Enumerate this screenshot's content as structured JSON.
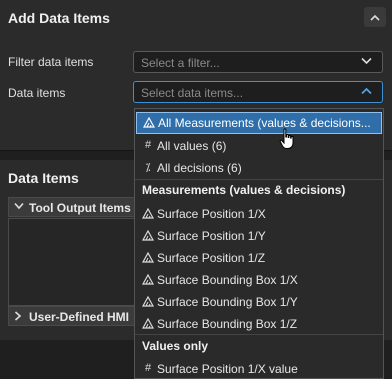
{
  "add_panel": {
    "title": "Add Data Items",
    "filter_label": "Filter data items",
    "filter_placeholder": "Select a filter...",
    "items_label": "Data items",
    "items_placeholder": "Select data items..."
  },
  "items_panel": {
    "title": "Data Items",
    "tool_output": "Tool Output Items",
    "user_defined": "User-Defined HMI"
  },
  "dropdown": {
    "top_options": [
      {
        "label": "All Measurements (values & decisions...",
        "icon": "measure-icon"
      },
      {
        "label": "All values (6)",
        "icon": "hash-icon",
        "glyph": "#"
      },
      {
        "label": "All decisions (6)",
        "icon": "decision-icon",
        "glyph": "⁒"
      }
    ],
    "group1": "Measurements (values & decisions)",
    "measurements": [
      "Surface Position 1/X",
      "Surface Position 1/Y",
      "Surface Position 1/Z",
      "Surface Bounding Box 1/X",
      "Surface Bounding Box 1/Y",
      "Surface Bounding Box 1/Z"
    ],
    "group2": "Values only",
    "values": [
      "Surface Position 1/X value"
    ]
  }
}
